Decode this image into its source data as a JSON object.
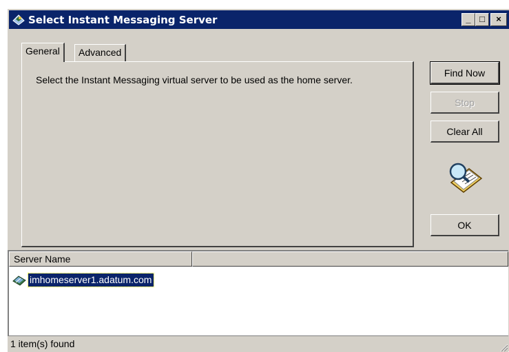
{
  "window": {
    "title": "Select Instant Messaging Server",
    "controls": {
      "minimize": "_",
      "maximize": "□",
      "close": "×"
    }
  },
  "tabs": [
    {
      "label": "General",
      "active": true
    },
    {
      "label": "Advanced",
      "active": false
    }
  ],
  "general_panel": {
    "description": "Select the Instant Messaging virtual server to be used as the home server."
  },
  "buttons": {
    "find_now": "Find Now",
    "stop": "Stop",
    "clear_all": "Clear All",
    "ok": "OK"
  },
  "results": {
    "columns": [
      "Server Name"
    ],
    "rows": [
      {
        "name": "imhomeserver1.adatum.com",
        "selected": true
      }
    ]
  },
  "status": {
    "text": "1 item(s) found"
  },
  "icons": {
    "title": "im-server-icon",
    "search": "search-magnifier-icon",
    "row": "server-icon"
  },
  "colors": {
    "title_bar": "#0a246a",
    "selection": "#0a246a",
    "face": "#d4d0c8"
  }
}
